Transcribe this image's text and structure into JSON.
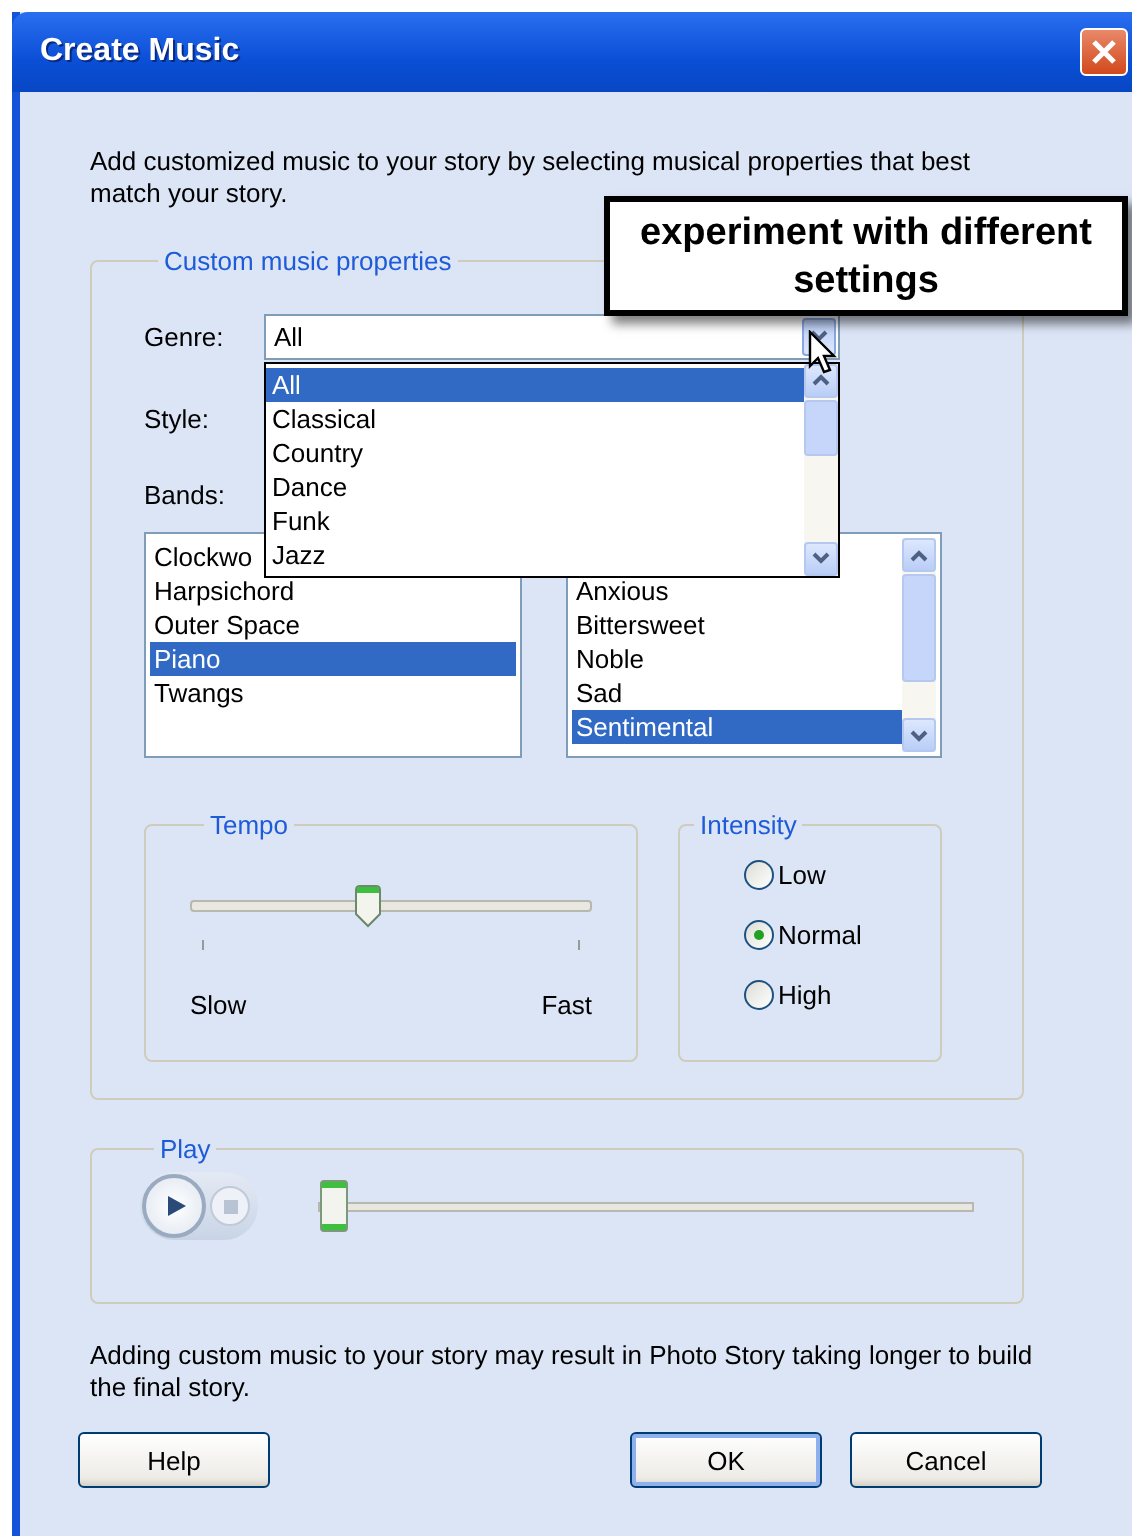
{
  "window": {
    "title": "Create Music"
  },
  "intro": "Add customized music to your story by selecting musical properties that best match your story.",
  "callout": "experiment with different settings",
  "properties": {
    "title": "Custom music properties",
    "genre": {
      "label": "Genre:",
      "value": "All",
      "expanded": true,
      "options": [
        {
          "label": "All",
          "selected": true
        },
        {
          "label": "Classical",
          "selected": false
        },
        {
          "label": "Country",
          "selected": false
        },
        {
          "label": "Dance",
          "selected": false
        },
        {
          "label": "Funk",
          "selected": false
        },
        {
          "label": "Jazz",
          "selected": false
        }
      ]
    },
    "style": {
      "label": "Style:"
    },
    "bands": {
      "label": "Bands:"
    },
    "band_list": [
      {
        "label": "Clockwo",
        "selected": false
      },
      {
        "label": "Harpsichord",
        "selected": false
      },
      {
        "label": "Outer Space",
        "selected": false
      },
      {
        "label": "Piano",
        "selected": true
      },
      {
        "label": "Twangs",
        "selected": false
      }
    ],
    "mood_list": [
      {
        "label": "Anxious",
        "selected": false
      },
      {
        "label": "Bittersweet",
        "selected": false
      },
      {
        "label": "Noble",
        "selected": false
      },
      {
        "label": "Sad",
        "selected": false
      },
      {
        "label": "Sentimental",
        "selected": true
      }
    ],
    "tempo": {
      "title": "Tempo",
      "level": 0.44,
      "min_label": "Slow",
      "max_label": "Fast"
    },
    "intensity": {
      "title": "Intensity",
      "options": [
        {
          "label": "Low",
          "selected": false
        },
        {
          "label": "Normal",
          "selected": true
        },
        {
          "label": "High",
          "selected": false
        }
      ]
    }
  },
  "play": {
    "title": "Play",
    "level": 0
  },
  "note": "Adding custom music to your story may result in Photo Story taking longer to build the final story.",
  "buttons": [
    {
      "label": "Help",
      "default": false
    },
    {
      "label": "OK",
      "default": true
    },
    {
      "label": "Cancel",
      "default": false
    }
  ]
}
